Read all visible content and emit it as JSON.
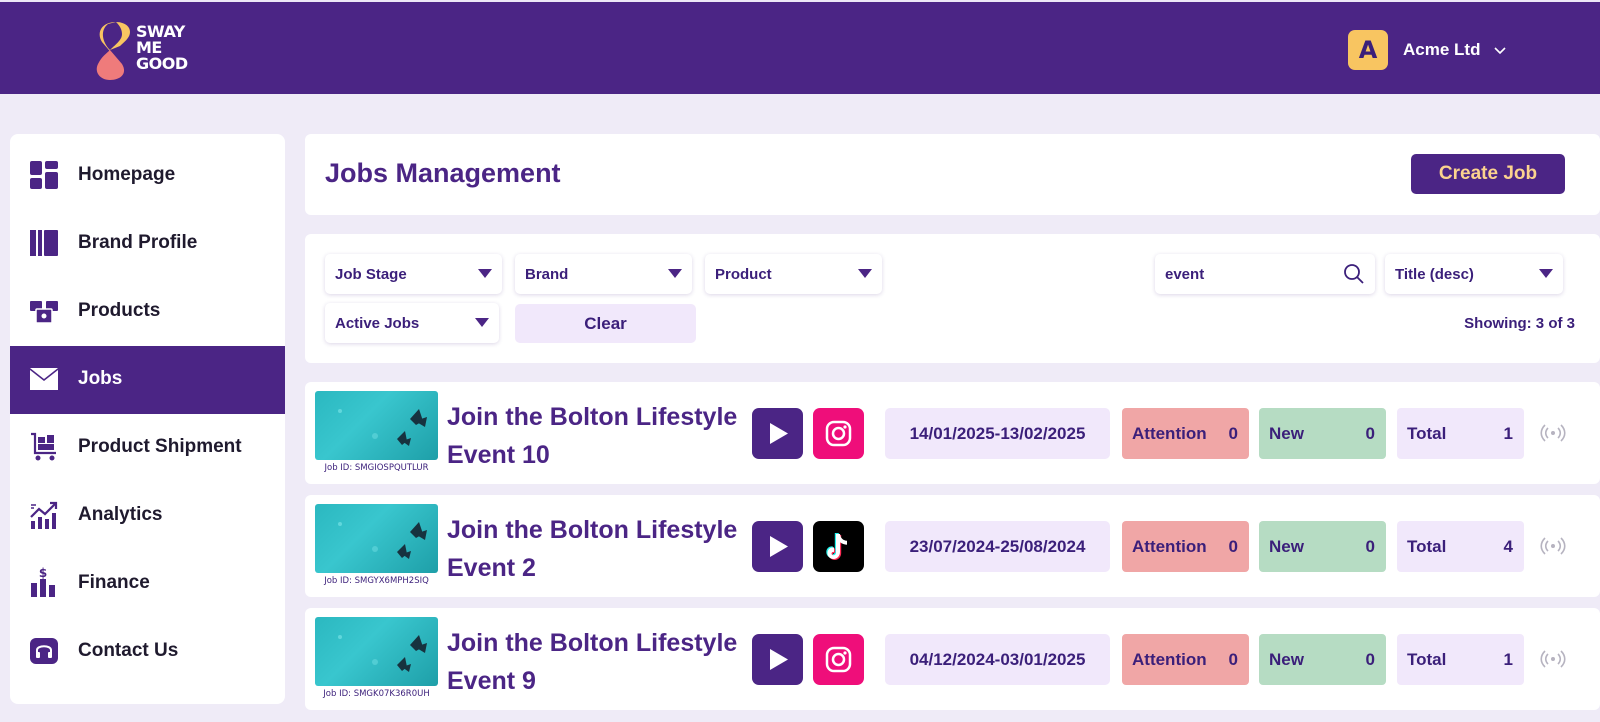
{
  "logo": {
    "line1": "SWAY",
    "line2": "ME",
    "line3": "GOOD"
  },
  "account": {
    "initial": "A",
    "name": "Acme Ltd"
  },
  "sidebar": {
    "items": [
      {
        "label": "Homepage",
        "icon": "dashboard-icon"
      },
      {
        "label": "Brand Profile",
        "icon": "brand-profile-icon"
      },
      {
        "label": "Products",
        "icon": "products-icon"
      },
      {
        "label": "Jobs",
        "icon": "envelope-icon",
        "active": true
      },
      {
        "label": "Product Shipment",
        "icon": "shipment-cart-icon"
      },
      {
        "label": "Analytics",
        "icon": "analytics-icon"
      },
      {
        "label": "Finance",
        "icon": "finance-icon"
      },
      {
        "label": "Contact Us",
        "icon": "headset-icon"
      }
    ]
  },
  "header": {
    "title": "Jobs Management",
    "create_label": "Create Job"
  },
  "filters": {
    "job_stage": "Job Stage",
    "brand": "Brand",
    "product": "Product",
    "active_jobs": "Active Jobs",
    "clear_label": "Clear",
    "search_value": "event",
    "sort": "Title (desc)",
    "showing": "Showing: 3 of 3"
  },
  "jobs": [
    {
      "title_line1": "Join the Bolton Lifestyle",
      "title_line2": "Event 10",
      "job_id": "Job ID: SMGIOSPQUTLUR",
      "platform": "instagram",
      "dates": "14/01/2025-13/02/2025",
      "attention_label": "Attention",
      "attention": "0",
      "new_label": "New",
      "new": "0",
      "total_label": "Total",
      "total": "1"
    },
    {
      "title_line1": "Join the Bolton Lifestyle",
      "title_line2": "Event 2",
      "job_id": "Job ID: SMGYX6MPH2SIQ",
      "platform": "tiktok",
      "dates": "23/07/2024-25/08/2024",
      "attention_label": "Attention",
      "attention": "0",
      "new_label": "New",
      "new": "0",
      "total_label": "Total",
      "total": "4"
    },
    {
      "title_line1": "Join the Bolton Lifestyle",
      "title_line2": "Event 9",
      "job_id": "Job ID: SMGK07K36R0UH",
      "platform": "instagram",
      "dates": "04/12/2024-03/01/2025",
      "attention_label": "Attention",
      "attention": "0",
      "new_label": "New",
      "new": "0",
      "total_label": "Total",
      "total": "1"
    }
  ],
  "colors": {
    "brand_purple": "#4b2585",
    "page_bg": "#efebf7",
    "accent_yellow": "#f8c561",
    "button_text": "#fbd38e",
    "instagram": "#ef0e7a",
    "tiktok": "#000000",
    "attention": "#f0a6a6",
    "new": "#b6dcc3",
    "total": "#f1e8fb"
  }
}
